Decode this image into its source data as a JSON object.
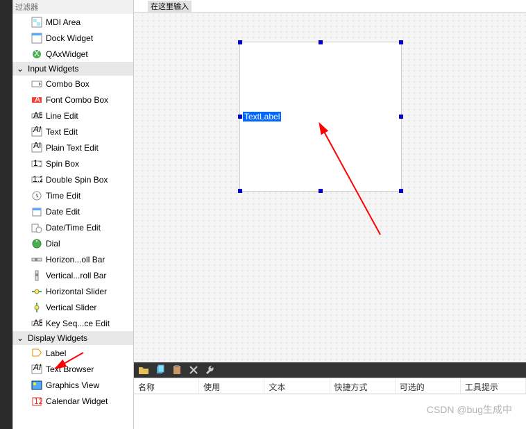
{
  "sidebar": {
    "filter_label": "过滤器",
    "items_top": [
      {
        "label": "MDI Area",
        "icon": "mdi-area-icon"
      },
      {
        "label": "Dock Widget",
        "icon": "dock-widget-icon"
      },
      {
        "label": "QAxWidget",
        "icon": "qax-widget-icon"
      }
    ],
    "group_input": "Input Widgets",
    "items_input": [
      {
        "label": "Combo Box"
      },
      {
        "label": "Font Combo Box"
      },
      {
        "label": "Line Edit"
      },
      {
        "label": "Text Edit"
      },
      {
        "label": "Plain Text Edit"
      },
      {
        "label": "Spin Box"
      },
      {
        "label": "Double Spin Box"
      },
      {
        "label": "Time Edit"
      },
      {
        "label": "Date Edit"
      },
      {
        "label": "Date/Time Edit"
      },
      {
        "label": "Dial"
      },
      {
        "label": "Horizon...oll Bar"
      },
      {
        "label": "Vertical...roll Bar"
      },
      {
        "label": "Horizontal Slider"
      },
      {
        "label": "Vertical Slider"
      },
      {
        "label": "Key Seq...ce Edit"
      }
    ],
    "group_display": "Display Widgets",
    "items_display": [
      {
        "label": "Label"
      },
      {
        "label": "Text Browser"
      },
      {
        "label": "Graphics View"
      },
      {
        "label": "Calendar Widget"
      }
    ]
  },
  "canvas": {
    "header_text": "在这里输入",
    "textlabel": "TextLabel"
  },
  "table_columns": [
    "名称",
    "使用",
    "文本",
    "快捷方式",
    "可选的",
    "工具提示"
  ],
  "watermark": "CSDN @bug生成中"
}
